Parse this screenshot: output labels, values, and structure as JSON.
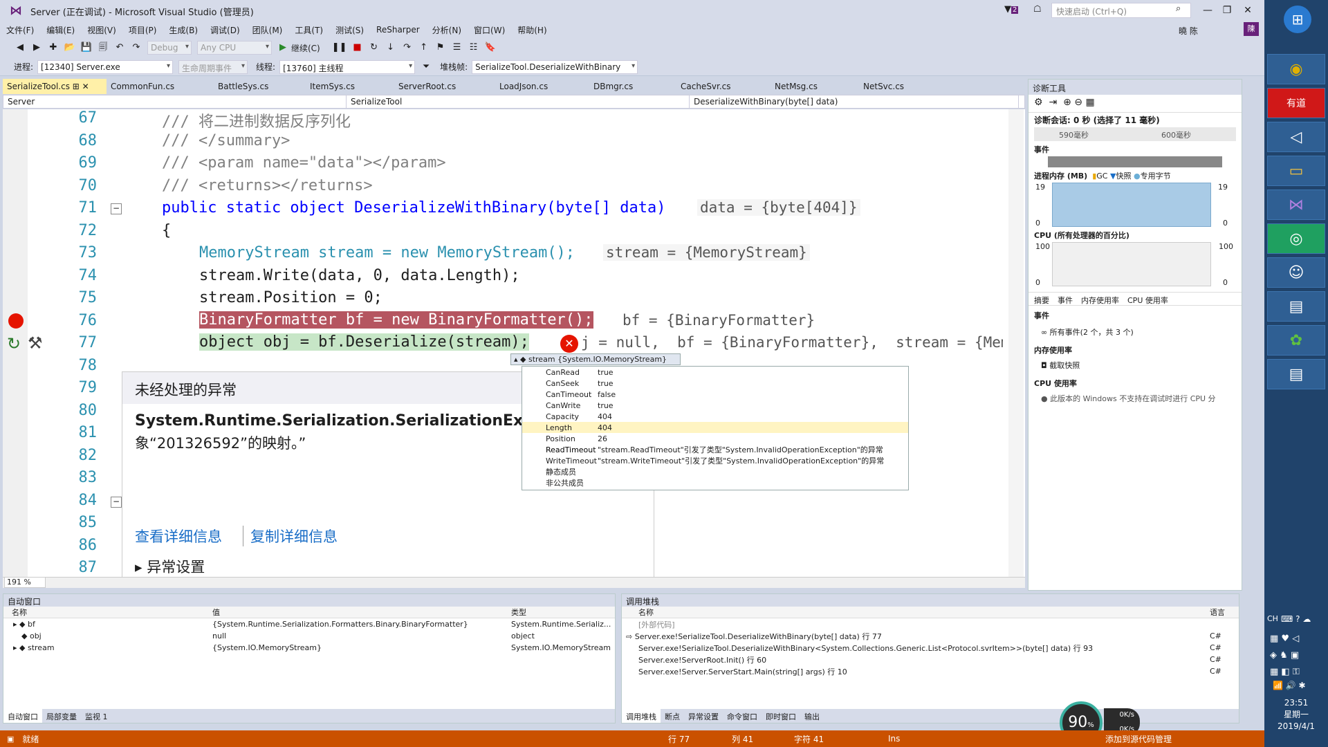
{
  "window": {
    "title": "Server (正在调试) - Microsoft Visual Studio (管理员)",
    "notification_count": "2",
    "quick_launch_placeholder": "快速启动 (Ctrl+Q)",
    "user": "曉 陈",
    "user_initials": "陳",
    "min": "—",
    "restore": "❐",
    "close": "✕"
  },
  "menu": [
    "文件(F)",
    "编辑(E)",
    "视图(V)",
    "项目(P)",
    "生成(B)",
    "调试(D)",
    "团队(M)",
    "工具(T)",
    "测试(S)",
    "ReSharper",
    "分析(N)",
    "窗口(W)",
    "帮助(H)"
  ],
  "toolbar": {
    "config": "Debug",
    "platform": "Any CPU",
    "continue": "继续(C)",
    "process_label": "进程:",
    "process": "[12340] Server.exe",
    "lifecycle": "生命周期事件",
    "thread_label": "线程:",
    "thread": "[13760] 主线程",
    "stack_label": "堆栈帧:",
    "stack": "SerializeTool.DeserializeWithBinary"
  },
  "tabs": [
    "SerializeTool.cs",
    "CommonFun.cs",
    "BattleSys.cs",
    "ItemSys.cs",
    "ServerRoot.cs",
    "LoadJson.cs",
    "DBmgr.cs",
    "CacheSvr.cs",
    "NetMsg.cs",
    "NetSvc.cs"
  ],
  "navbar": {
    "project": "Server",
    "class": "SerializeTool",
    "method": "DeserializeWithBinary(byte[] data)"
  },
  "editor": {
    "zoom": "191 %",
    "lines": [
      {
        "n": "67",
        "text": "/// 将二进制数据反序列化"
      },
      {
        "n": "68",
        "text": "/// </summary>"
      },
      {
        "n": "69",
        "text": "/// <param name=\"data\"></param>"
      },
      {
        "n": "70",
        "text": "/// <returns></returns>"
      },
      {
        "n": "71",
        "text": "public static object DeserializeWithBinary(byte[] data)"
      },
      {
        "n": "72",
        "text": "{"
      },
      {
        "n": "73",
        "text": "MemoryStream stream = new MemoryStream();"
      },
      {
        "n": "74",
        "text": "stream.Write(data, 0, data.Length);"
      },
      {
        "n": "75",
        "text": "stream.Position = 0;"
      },
      {
        "n": "76",
        "text": "BinaryFormatter bf = new BinaryFormatter();"
      },
      {
        "n": "77",
        "text": "object obj = bf.Deserialize(stream);"
      },
      {
        "n": "78",
        "text": ""
      },
      {
        "n": "79",
        "text": ""
      },
      {
        "n": "80",
        "text": ""
      },
      {
        "n": "81",
        "text": ""
      },
      {
        "n": "82",
        "text": ""
      },
      {
        "n": "83",
        "text": ""
      },
      {
        "n": "84",
        "text": ""
      },
      {
        "n": "85",
        "text": ""
      },
      {
        "n": "86",
        "text": ""
      },
      {
        "n": "87",
        "text": ""
      }
    ],
    "tips": {
      "l71": "data = {byte[404]}",
      "l73": "stream = {MemoryStream}",
      "l76": "bf = {BinaryFormatter}",
      "l77": "j = null,  bf = {BinaryFormatter},  stream = {MemoryStr"
    }
  },
  "exception": {
    "header": "未经处理的异常",
    "type": "System.Runtime.Serialization.SerializationExcept",
    "message": "象“201326592”的映射。”",
    "link_details": "查看详细信息",
    "link_copy": "复制详细信息",
    "settings": "异常设置"
  },
  "datatip": {
    "header": "stream {System.IO.MemoryStream}",
    "rows": [
      {
        "name": "CanRead",
        "value": "true"
      },
      {
        "name": "CanSeek",
        "value": "true"
      },
      {
        "name": "CanTimeout",
        "value": "false"
      },
      {
        "name": "CanWrite",
        "value": "true"
      },
      {
        "name": "Capacity",
        "value": "404"
      },
      {
        "name": "Length",
        "value": "404"
      },
      {
        "name": "Position",
        "value": "26"
      },
      {
        "name": "ReadTimeout",
        "value": "\"stream.ReadTimeout\"引发了类型\"System.InvalidOperationException\"的异常"
      },
      {
        "name": "WriteTimeout",
        "value": "\"stream.WriteTimeout\"引发了类型\"System.InvalidOperationException\"的异常"
      },
      {
        "name": "静态成员",
        "value": ""
      },
      {
        "name": "非公共成员",
        "value": ""
      }
    ]
  },
  "diag": {
    "title": "诊断工具",
    "session": "诊断会话: 0 秒 (选择了 11 毫秒)",
    "t1": "590毫秒",
    "t2": "600毫秒",
    "events": "事件",
    "memory": "进程内存 (MB)",
    "legend_gc": "GC",
    "legend_snap": "快照",
    "legend_priv": "专用字节",
    "mem_max": "19",
    "mem_min": "0",
    "cpu": "CPU (所有处理器的百分比)",
    "cpu_max": "100",
    "cpu_min": "0",
    "subtabs": [
      "摘要",
      "事件",
      "内存使用率",
      "CPU 使用率"
    ],
    "sec_events": "事件",
    "all_events": "所有事件(2 个，共 3 个)",
    "sec_mem": "内存使用率",
    "snapshot": "截取快照",
    "sec_cpu": "CPU 使用率",
    "cpu_note": "此版本的 Windows 不支持在调试时进行 CPU 分"
  },
  "autos": {
    "title": "自动窗口",
    "cols": [
      "名称",
      "值",
      "类型"
    ],
    "rows": [
      {
        "name": "bf",
        "value": "{System.Runtime.Serialization.Formatters.Binary.BinaryFormatter}",
        "type": "System.Runtime.Serializ..."
      },
      {
        "name": "obj",
        "value": "null",
        "type": "object"
      },
      {
        "name": "stream",
        "value": "{System.IO.MemoryStream}",
        "type": "System.IO.MemoryStream"
      }
    ],
    "tabs": [
      "自动窗口",
      "局部变量",
      "监视 1"
    ]
  },
  "callstack": {
    "title": "调用堆栈",
    "cols": [
      "名称",
      "语言"
    ],
    "rows": [
      {
        "name": "[外部代码]",
        "lang": ""
      },
      {
        "name": "Server.exe!SerializeTool.DeserializeWithBinary(byte[] data) 行 77",
        "lang": "C#"
      },
      {
        "name": "Server.exe!SerializeTool.DeserializeWithBinary<System.Collections.Generic.List<Protocol.svrItem>>(byte[] data) 行 93",
        "lang": "C#"
      },
      {
        "name": "Server.exe!ServerRoot.Init() 行 60",
        "lang": "C#"
      },
      {
        "name": "Server.exe!Server.ServerStart.Main(string[] args) 行 10",
        "lang": "C#"
      }
    ],
    "tabs": [
      "调用堆栈",
      "断点",
      "异常设置",
      "命令窗口",
      "即时窗口",
      "输出"
    ]
  },
  "status": {
    "ready": "就绪",
    "line": "行 77",
    "col": "列 41",
    "char": "字符 41",
    "ins": "Ins",
    "source": "添加到源代码管理",
    "gauge": "90",
    "net_up": "0K/s",
    "net_down": "0K/s"
  },
  "taskbar": {
    "lang": "CH",
    "time": "23:51",
    "weekday": "星期一",
    "date": "2019/4/1",
    "youdao": "有道"
  }
}
